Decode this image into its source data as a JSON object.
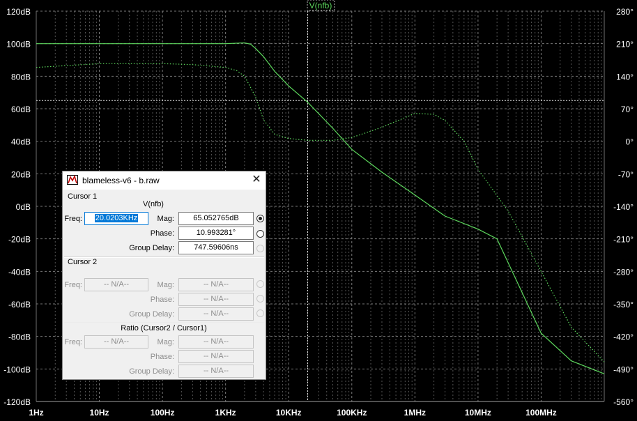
{
  "trace_title": "V(nfb)",
  "colors": {
    "trace": "#5cd65c",
    "grid": "#7a7a7a",
    "axis_text": "#ffffff",
    "background": "#000000"
  },
  "chart_data": {
    "type": "line",
    "title": "V(nfb)",
    "x_scale": "log",
    "xlim": [
      1,
      1000000000
    ],
    "ylim_mag_db": [
      -120,
      120
    ],
    "ylim_phase_deg": [
      -560,
      280
    ],
    "x_ticks": [
      "1Hz",
      "10Hz",
      "100Hz",
      "1KHz",
      "10KHz",
      "100KHz",
      "1MHz",
      "10MHz",
      "100MHz"
    ],
    "y_left_ticks": [
      "120dB",
      "100dB",
      "80dB",
      "60dB",
      "40dB",
      "20dB",
      "0dB",
      "-20dB",
      "-40dB",
      "-60dB",
      "-80dB",
      "-100dB",
      "-120dB"
    ],
    "y_right_ticks": [
      "280°",
      "210°",
      "140°",
      "70°",
      "0°",
      "-70°",
      "-140°",
      "-210°",
      "-280°",
      "-350°",
      "-420°",
      "-490°",
      "-560°"
    ],
    "grid": true,
    "series": [
      {
        "style": "solid",
        "axis": "left",
        "x": [
          1,
          10,
          100,
          1000,
          1500,
          2000,
          2500,
          3000,
          4000,
          6000,
          10000,
          20000,
          50000,
          100000,
          300000,
          1000000,
          3000000,
          10000000,
          20000000,
          40000000,
          100000000,
          300000000,
          1000000000
        ],
        "values": [
          100,
          100,
          100,
          100,
          100.3,
          100.5,
          99.7,
          97,
          92,
          83,
          74,
          64,
          48,
          35,
          21,
          7,
          -6,
          -14,
          -20,
          -45,
          -78,
          -95,
          -103
        ]
      },
      {
        "style": "dotted",
        "axis": "right",
        "x": [
          1,
          10,
          100,
          300,
          1000,
          1500,
          2000,
          3000,
          4000,
          6000,
          10000,
          20000,
          50000,
          100000,
          300000,
          1000000,
          2000000,
          3000000,
          6000000,
          10000000,
          30000000,
          100000000,
          300000000,
          1000000000
        ],
        "values": [
          159,
          167,
          167,
          165,
          159,
          152,
          140,
          95,
          46,
          15,
          6,
          2,
          2,
          8,
          30,
          60,
          58,
          45,
          0,
          -60,
          -150,
          -280,
          -400,
          -475
        ]
      }
    ],
    "cursor": {
      "x": 20020.3,
      "y_db": 65.052765
    }
  },
  "dialog": {
    "title": "blameless-v6 - b.raw",
    "cursor1": {
      "heading": "Cursor 1",
      "trace": "V(nfb)",
      "freq_label": "Freq:",
      "freq_value": "20.0203KHz",
      "mag_label": "Mag:",
      "mag_value": "65.052765dB",
      "phase_label": "Phase:",
      "phase_value": "10.993281°",
      "group_delay_label": "Group Delay:",
      "group_delay_value": "747.59606ns"
    },
    "cursor2": {
      "heading": "Cursor 2",
      "freq_label": "Freq:",
      "freq_value": "-- N/A--",
      "mag_label": "Mag:",
      "mag_value": "-- N/A--",
      "phase_label": "Phase:",
      "phase_value": "-- N/A--",
      "group_delay_label": "Group Delay:",
      "group_delay_value": "-- N/A--"
    },
    "ratio": {
      "heading": "Ratio (Cursor2 / Cursor1)",
      "freq_label": "Freq:",
      "freq_value": "-- N/A--",
      "mag_label": "Mag:",
      "mag_value": "-- N/A--",
      "phase_label": "Phase:",
      "phase_value": "-- N/A--",
      "group_delay_label": "Group Delay:",
      "group_delay_value": "-- N/A--"
    }
  }
}
